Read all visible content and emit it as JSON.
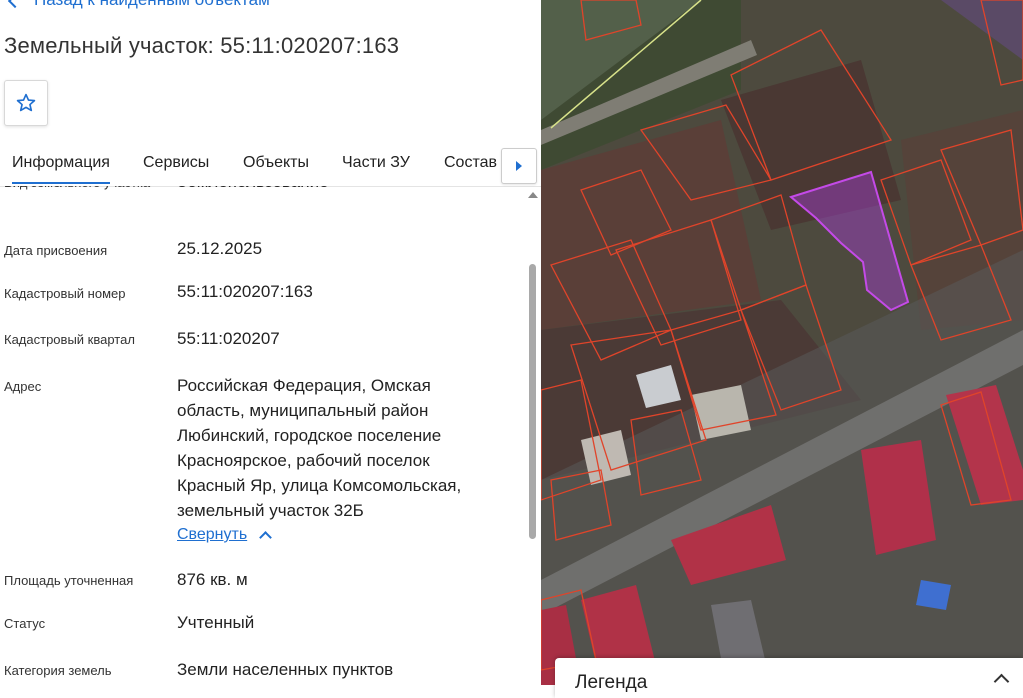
{
  "back_link": {
    "label": "Назад к найденным объектам"
  },
  "page_title": "Земельный участок: 55:11:020207:163",
  "tabs": [
    {
      "label": "Информация",
      "active": true
    },
    {
      "label": "Сервисы"
    },
    {
      "label": "Объекты"
    },
    {
      "label": "Части ЗУ"
    },
    {
      "label": "Состав"
    }
  ],
  "fields": [
    {
      "label": "Вид земельного участка",
      "value": "Землепользование"
    },
    {
      "label": "Дата присвоения",
      "value": "25.12.2025"
    },
    {
      "label": "Кадастровый номер",
      "value": "55:11:020207:163"
    },
    {
      "label": "Кадастровый квартал",
      "value": "55:11:020207"
    },
    {
      "label": "Адрес",
      "value": "Российская Федерация, Омская область, муниципальный район Любинский, городское поселение Красноярское, рабочий поселок Красный Яр, улица Комсомольская, земельный участок 32Б"
    },
    {
      "label": "Площадь уточненная",
      "value": "876 кв. м"
    },
    {
      "label": "Статус",
      "value": "Учтенный"
    },
    {
      "label": "Категория земель",
      "value": "Земли населенных пунктов"
    }
  ],
  "collapse_link": "Свернуть",
  "legend": {
    "title": "Легенда"
  },
  "colors": {
    "accent": "#1f6fd0",
    "parcel_border": "#e0442a",
    "selected_parcel": "#b03ad8"
  }
}
